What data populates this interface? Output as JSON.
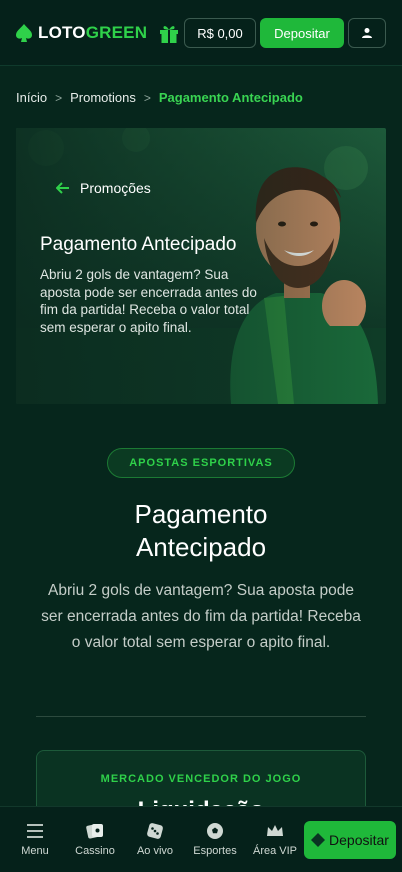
{
  "header": {
    "logo_part1": "LOTO",
    "logo_part2": "GREEN",
    "balance": "R$ 0,00",
    "deposit_label": "Depositar"
  },
  "breadcrumb": {
    "items": [
      "Início",
      "Promotions",
      "Pagamento Antecipado"
    ],
    "separator": ">"
  },
  "hero": {
    "back_label": "Promoções",
    "title": "Pagamento Antecipado",
    "text": "Abriu 2 gols de vantagem? Sua aposta pode ser encerrada antes do fim da partida! Receba o valor total sem esperar o apito final."
  },
  "main": {
    "badge": "APOSTAS ESPORTIVAS",
    "title": "Pagamento Antecipado",
    "text": "Abriu 2 gols de vantagem? Sua aposta pode ser encerrada antes do fim da partida! Receba o valor total sem esperar o apito final."
  },
  "market_card": {
    "label": "MERCADO VENCEDOR DO JOGO",
    "value": "Liquidação"
  },
  "bottom_nav": {
    "items": [
      "Menu",
      "Cassino",
      "Ao vivo",
      "Esportes",
      "Área VIP"
    ],
    "deposit_label": "Depositar"
  },
  "colors": {
    "accent": "#1fb83a",
    "background": "#06261c",
    "header": "#05211a"
  }
}
